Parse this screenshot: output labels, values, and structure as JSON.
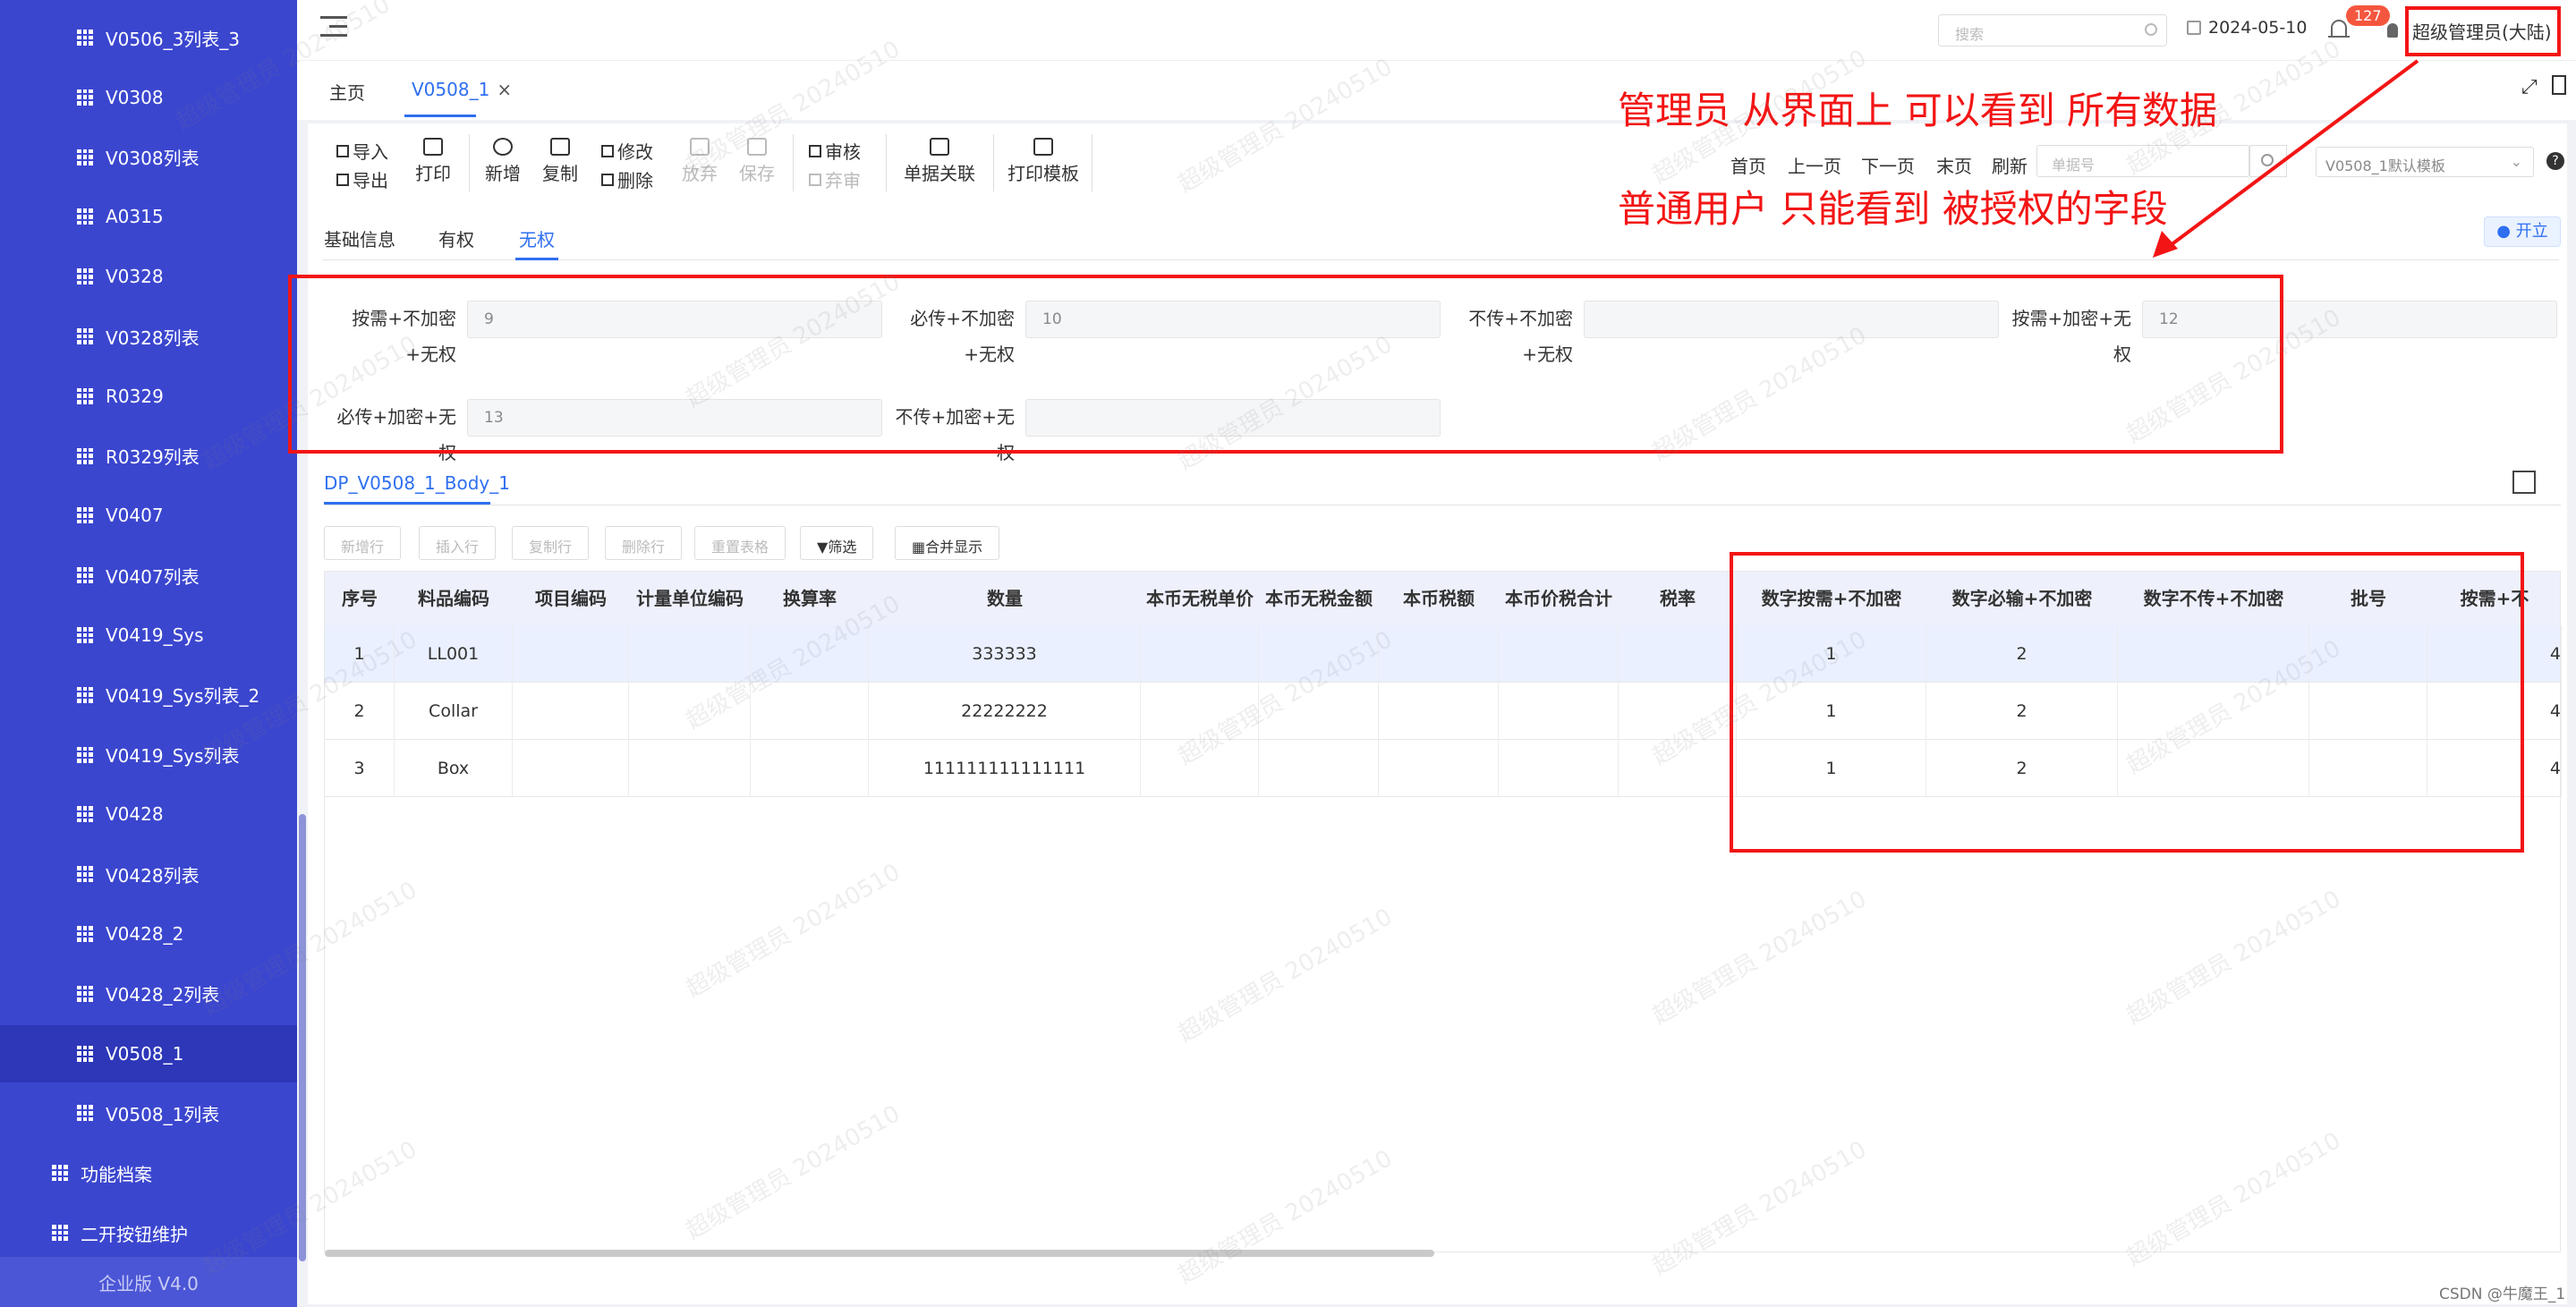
{
  "sidebar": {
    "items": [
      {
        "label": "V0506_3列表_3",
        "level": "sub"
      },
      {
        "label": "V0308",
        "level": "sub"
      },
      {
        "label": "V0308列表",
        "level": "sub"
      },
      {
        "label": "A0315",
        "level": "sub"
      },
      {
        "label": "V0328",
        "level": "sub"
      },
      {
        "label": "V0328列表",
        "level": "sub"
      },
      {
        "label": "R0329",
        "level": "sub"
      },
      {
        "label": "R0329列表",
        "level": "sub"
      },
      {
        "label": "V0407",
        "level": "sub"
      },
      {
        "label": "V0407列表",
        "level": "sub"
      },
      {
        "label": "V0419_Sys",
        "level": "sub"
      },
      {
        "label": "V0419_Sys列表_2",
        "level": "sub"
      },
      {
        "label": "V0419_Sys列表",
        "level": "sub"
      },
      {
        "label": "V0428",
        "level": "sub"
      },
      {
        "label": "V0428列表",
        "level": "sub"
      },
      {
        "label": "V0428_2",
        "level": "sub"
      },
      {
        "label": "V0428_2列表",
        "level": "sub"
      },
      {
        "label": "V0508_1",
        "level": "sub",
        "active": true
      },
      {
        "label": "V0508_1列表",
        "level": "sub"
      },
      {
        "label": "功能档案",
        "level": "top"
      },
      {
        "label": "二开按钮维护",
        "level": "top"
      }
    ],
    "footer": "企业版 V4.0"
  },
  "header": {
    "search_placeholder": "搜索",
    "date": "2024-05-10",
    "notification_count": "127",
    "user": "超级管理员(大陆)"
  },
  "tabs": [
    {
      "label": "主页"
    },
    {
      "label": "V0508_1",
      "close": "×"
    }
  ],
  "toolbar": {
    "import": "导入",
    "export": "导出",
    "print": "打印",
    "add": "新增",
    "copy": "复制",
    "edit": "修改",
    "delete": "删除",
    "discard": "放弃",
    "save": "保存",
    "audit": "审核",
    "abandon": "弃审",
    "link": "单据关联",
    "print_template": "打印模板"
  },
  "nav": {
    "first": "首页",
    "prev": "上一页",
    "next": "下一页",
    "last": "末页",
    "refresh": "刷新",
    "doc_no_placeholder": "单据号",
    "template": "V0508_1默认模板"
  },
  "section_tabs": [
    "基础信息",
    "有权",
    "无权"
  ],
  "kai_button": "● 开立",
  "form": {
    "f1_label": "按需+不加密+无权",
    "f1_value": "9",
    "f2_label": "必传+不加密+无权",
    "f2_value": "10",
    "f3_label": "不传+不加密+无权",
    "f3_value": "",
    "f4_label": "按需+加密+无权",
    "f4_value": "12",
    "f5_label": "必传+加密+无权",
    "f5_value": "13",
    "f6_label": "不传+加密+无权",
    "f6_value": ""
  },
  "body_tab": "DP_V0508_1_Body_1",
  "grid_buttons": {
    "new_row": "新增行",
    "insert_row": "插入行",
    "copy_row": "复制行",
    "delete_row": "删除行",
    "reset": "重置表格",
    "filter": "筛选",
    "merge": "合并显示"
  },
  "grid": {
    "columns": [
      "序号",
      "料品编码",
      "项目编码",
      "计量单位编码",
      "换算率",
      "数量",
      "本币无税单价",
      "本币无税金额",
      "本币税额",
      "本币价税合计",
      "税率",
      "数字按需+不加密",
      "数字必输+不加密",
      "数字不传+不加密",
      "批号",
      "按需+不"
    ],
    "rows": [
      [
        "1",
        "LL001",
        "",
        "",
        "",
        "333333",
        "",
        "",
        "",
        "",
        "",
        "1",
        "2",
        "",
        "",
        "4"
      ],
      [
        "2",
        "Collar",
        "",
        "",
        "",
        "22222222",
        "",
        "",
        "",
        "",
        "",
        "1",
        "2",
        "",
        "",
        "4"
      ],
      [
        "3",
        "Box",
        "",
        "",
        "",
        "111111111111111",
        "",
        "",
        "",
        "",
        "",
        "1",
        "2",
        "",
        "",
        "4"
      ]
    ]
  },
  "annotations": {
    "line1": "管理员 从界面上 可以看到 所有数据",
    "line2": "普通用户 只能看到 被授权的字段",
    "color": "#f31515"
  },
  "watermark": "超级管理员 20240510",
  "credit": "CSDN @牛魔王_1"
}
